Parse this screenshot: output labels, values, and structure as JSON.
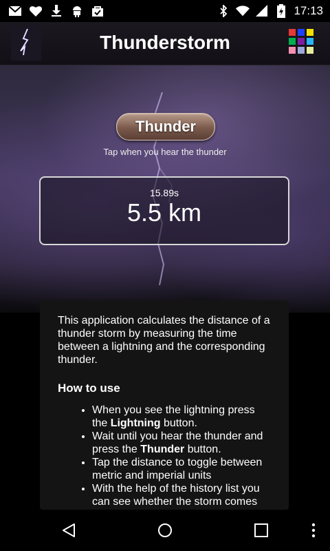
{
  "status_bar": {
    "time": "17:13",
    "left_icons": [
      "gmail-icon",
      "heart-icon",
      "download-icon",
      "android-icon",
      "bag-icon"
    ],
    "right_icons": [
      "bluetooth-icon",
      "wifi-icon",
      "signal-icon",
      "battery-icon"
    ]
  },
  "action_bar": {
    "title": "Thunderstorm",
    "app_icon": "lightning-bolt-icon",
    "menu_icon": "color-grid-icon",
    "grid_colors": [
      "#e53935",
      "#1e40ff",
      "#f4e300",
      "#00b050",
      "#7b1fa2",
      "#29b6f6",
      "#f48fb1",
      "#9fa8da",
      "#e6ee9c"
    ]
  },
  "main": {
    "thunder_button_label": "Thunder",
    "hint": "Tap when you hear the thunder",
    "elapsed_time": "15.89s",
    "distance": "5.5 km"
  },
  "info": {
    "intro": "This application calculates the distance of a thunder storm by measuring the time between a lightning and the corresponding thunder.",
    "how_to_title": "How to use",
    "steps": [
      {
        "before": "When you see the lightning press the ",
        "bold": "Lightning",
        "after": " button."
      },
      {
        "before": "Wait until you hear the thunder and press the ",
        "bold": "Thunder",
        "after": " button."
      },
      {
        "before": "Tap the distance to toggle between metric and imperial units",
        "bold": "",
        "after": ""
      },
      {
        "before": "With the help of the history list you can see whether the storm comes",
        "bold": "",
        "after": ""
      }
    ]
  },
  "nav_bar": {
    "back_icon": "back-icon",
    "home_icon": "home-icon",
    "recents_icon": "recents-icon",
    "overflow_icon": "overflow-menu-icon"
  },
  "colors": {
    "accent_button": "#7b5a4c",
    "card_background": "#141414"
  }
}
